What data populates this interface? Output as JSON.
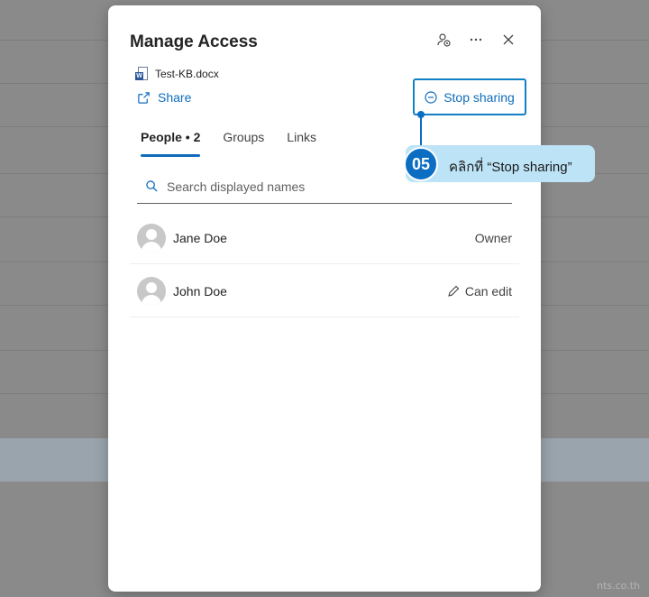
{
  "dialog": {
    "title": "Manage Access",
    "file_name": "Test-KB.docx",
    "share_label": "Share",
    "stop_sharing_label": "Stop sharing",
    "tabs": [
      {
        "label": "People • 2",
        "active": true
      },
      {
        "label": "Groups",
        "active": false
      },
      {
        "label": "Links",
        "active": false
      }
    ],
    "search_placeholder": "Search displayed names",
    "people": [
      {
        "name": "Jane Doe",
        "role": "Owner"
      },
      {
        "name": "John Doe",
        "role": "Can edit"
      }
    ]
  },
  "callout": {
    "step": "05",
    "text": "คลิกที่ “Stop sharing”"
  },
  "watermark": "nts.co.th",
  "colors": {
    "accent": "#0f6cbd",
    "callout_bg": "#bde3f6",
    "callout_badge": "#0b6ec3"
  }
}
